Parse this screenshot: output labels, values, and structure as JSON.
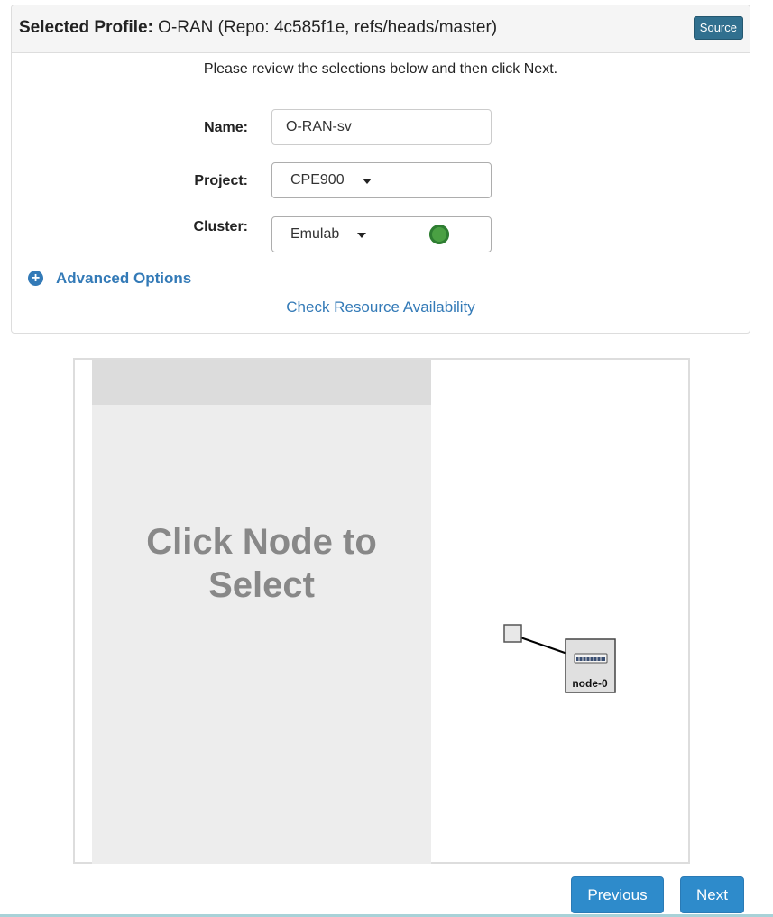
{
  "profile_header": {
    "label": "Selected Profile:",
    "value": "O-RAN (Repo: 4c585f1e, refs/heads/master)",
    "source_button": "Source"
  },
  "instructions": "Please review the selections below and then click Next.",
  "form": {
    "name_label": "Name:",
    "name_value": "O-RAN-sv",
    "project_label": "Project:",
    "project_value": "CPE900",
    "cluster_label": "Cluster:",
    "cluster_value": "Emulab",
    "cluster_status_color": "#4aa043"
  },
  "advanced_options": "Advanced Options",
  "check_availability": "Check Resource Availability",
  "topology": {
    "side_message": "Click Node to Select",
    "node_label": "node-0"
  },
  "buttons": {
    "previous": "Previous",
    "next": "Next"
  },
  "colors": {
    "link": "#337ab7",
    "primary_button": "#2e8bcb",
    "source_button": "#31708f"
  }
}
